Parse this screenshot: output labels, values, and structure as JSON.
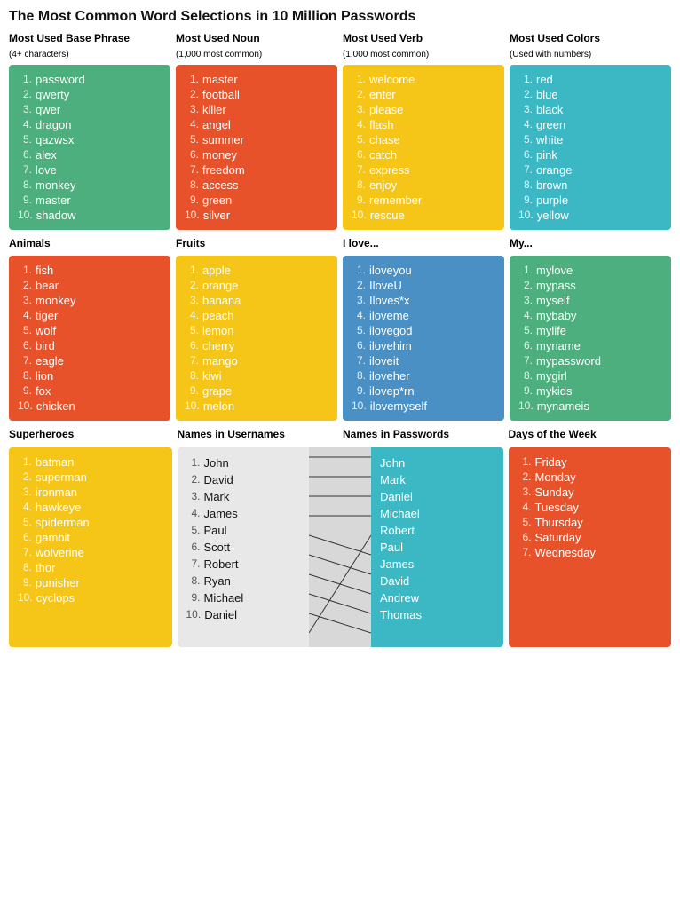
{
  "title": "The Most Common Word Selections in 10 Million Passwords",
  "sections": {
    "row1": [
      {
        "id": "base-phrase",
        "color": "green",
        "title": "Most Used Base Phrase",
        "subtitle": "(4+ characters)",
        "items": [
          "password",
          "qwerty",
          "qwer",
          "dragon",
          "qazwsx",
          "alex",
          "love",
          "monkey",
          "master",
          "shadow"
        ]
      },
      {
        "id": "noun",
        "color": "orange-red",
        "title": "Most Used Noun",
        "subtitle": "(1,000 most common)",
        "items": [
          "master",
          "football",
          "killer",
          "angel",
          "summer",
          "money",
          "freedom",
          "access",
          "green",
          "silver"
        ]
      },
      {
        "id": "verb",
        "color": "yellow",
        "title": "Most Used Verb",
        "subtitle": "(1,000 most common)",
        "items": [
          "welcome",
          "enter",
          "please",
          "flash",
          "chase",
          "catch",
          "express",
          "enjoy",
          "remember",
          "rescue"
        ]
      },
      {
        "id": "colors",
        "color": "teal",
        "title": "Most Used Colors",
        "subtitle": "(Used with numbers)",
        "items": [
          "red",
          "blue",
          "black",
          "green",
          "white",
          "pink",
          "orange",
          "brown",
          "purple",
          "yellow"
        ]
      }
    ],
    "row2": [
      {
        "id": "animals",
        "color": "red",
        "title": "Animals",
        "subtitle": "",
        "items": [
          "fish",
          "bear",
          "monkey",
          "tiger",
          "wolf",
          "bird",
          "eagle",
          "lion",
          "fox",
          "chicken"
        ]
      },
      {
        "id": "fruits",
        "color": "yellow2",
        "title": "Fruits",
        "subtitle": "",
        "items": [
          "apple",
          "orange",
          "banana",
          "peach",
          "lemon",
          "cherry",
          "mango",
          "kiwi",
          "grape",
          "melon"
        ]
      },
      {
        "id": "ilove",
        "color": "blue",
        "title": "I love...",
        "subtitle": "",
        "items": [
          "iloveyou",
          "IloveU",
          "Iloves*x",
          "iloveme",
          "ilovegod",
          "ilovehim",
          "iloveit",
          "iloveher",
          "ilovep*rn",
          "ilovemyself"
        ]
      },
      {
        "id": "my",
        "color": "green2",
        "title": "My...",
        "subtitle": "",
        "items": [
          "mylove",
          "mypass",
          "myself",
          "mybaby",
          "mylife",
          "myname",
          "mypassword",
          "mygirl",
          "mykids",
          "mynameis"
        ]
      }
    ],
    "row3": {
      "superheroes": {
        "id": "superheroes",
        "color": "yellow2",
        "title": "Superheroes",
        "items": [
          "batman",
          "superman",
          "ironman",
          "hawkeye",
          "spiderman",
          "gambit",
          "wolverine",
          "thor",
          "punisher",
          "cyclops"
        ]
      },
      "usernames": [
        "John",
        "David",
        "Mark",
        "James",
        "Paul",
        "Scott",
        "Robert",
        "Ryan",
        "Michael",
        "Daniel"
      ],
      "passwords": [
        "John",
        "Mark",
        "Daniel",
        "Michael",
        "Robert",
        "Paul",
        "James",
        "David",
        "Andrew",
        "Thomas"
      ],
      "connections": [
        [
          0,
          0
        ],
        [
          1,
          1
        ],
        [
          2,
          2
        ],
        [
          3,
          3
        ],
        [
          4,
          5
        ],
        [
          5,
          6
        ],
        [
          6,
          7
        ],
        [
          7,
          8
        ],
        [
          8,
          9
        ],
        [
          9,
          4
        ]
      ],
      "days": {
        "id": "days",
        "color": "orange-red",
        "title": "Days of the Week",
        "items": [
          "Friday",
          "Monday",
          "Sunday",
          "Tuesday",
          "Thursday",
          "Saturday",
          "Wednesday"
        ]
      }
    }
  }
}
